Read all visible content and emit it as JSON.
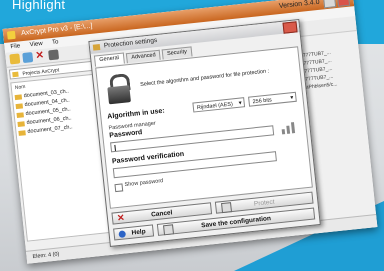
{
  "header": {
    "text": "Highlight",
    "color": "#21a7db"
  },
  "app": {
    "title": "AxCrypt Pro v3 - [E:\\...]",
    "version": "Version 3.4.0",
    "menu": [
      "File",
      "View",
      "To"
    ],
    "address": "Projects AxCrypt",
    "tree_header": "Nom",
    "files": [
      "document_03_ch..",
      "document_04_ch..",
      "document_05_ch..",
      "document_06_ch..",
      "document_07_ch.."
    ],
    "right_list": [
      "xxxxxx2777TUB7_...",
      "xxxxxx2777TUB7_...",
      "xxxxxx2777TUB7_...",
      "xxxxxx2777TUB7_...",
      "TomlxPlaPhblsen5/c..."
    ],
    "status": "Elem: 4 (0)"
  },
  "dialog": {
    "title": "Protection settings",
    "tabs": [
      "General",
      "Advanced",
      "Security"
    ],
    "description": "Select the algorithm and password for file protection :",
    "algo_label": "Algorithm in use:",
    "algo_value": "Rijndael (AES)",
    "bits_value": "256 bits",
    "password_manager_label": "Password manager",
    "password_label": "Password",
    "password_verification_label": "Password verification",
    "show_password_label": "Show password",
    "cancel_label": "Cancel",
    "protect_label": "Protect",
    "help_label": "Help",
    "save_label": "Save the configuration"
  },
  "icons": [
    "lock-icon",
    "x-icon",
    "help-icon",
    "save-icon",
    "folder-icon",
    "password-generator-icon"
  ]
}
